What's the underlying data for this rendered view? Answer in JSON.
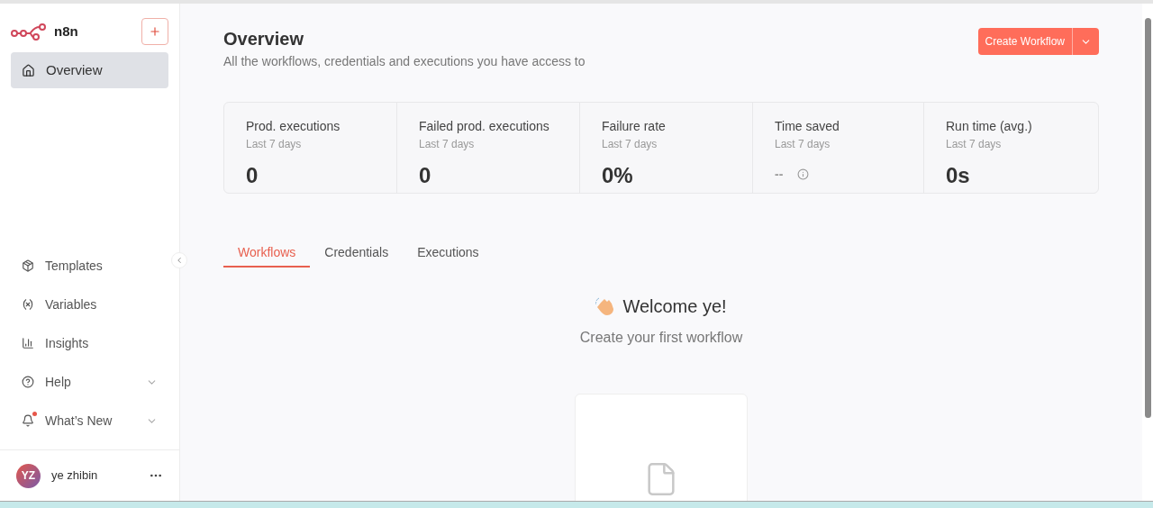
{
  "sidebar": {
    "brand": "n8n",
    "items": [
      {
        "kind": "home",
        "label": "Overview",
        "selected": true
      }
    ],
    "bottom_items": [
      {
        "kind": "templates",
        "label": "Templates",
        "expandable": false,
        "badge": false
      },
      {
        "kind": "variables",
        "label": "Variables",
        "expandable": false,
        "badge": false
      },
      {
        "kind": "insights",
        "label": "Insights",
        "expandable": false,
        "badge": false
      },
      {
        "kind": "help",
        "label": "Help",
        "expandable": true,
        "badge": false
      },
      {
        "kind": "news",
        "label": "What’s New",
        "expandable": true,
        "badge": true
      }
    ],
    "user": {
      "initials": "YZ",
      "name": "ye zhibin"
    }
  },
  "header": {
    "title": "Overview",
    "subtitle": "All the workflows, credentials and executions you have access to",
    "button": "Create Workflow"
  },
  "stats": [
    {
      "label": "Prod. executions",
      "period": "Last 7 days",
      "value": "0",
      "muted": false,
      "info": false
    },
    {
      "label": "Failed prod. executions",
      "period": "Last 7 days",
      "value": "0",
      "muted": false,
      "info": false
    },
    {
      "label": "Failure rate",
      "period": "Last 7 days",
      "value": "0%",
      "muted": false,
      "info": false
    },
    {
      "label": "Time saved",
      "period": "Last 7 days",
      "value": "--",
      "muted": true,
      "info": true
    },
    {
      "label": "Run time (avg.)",
      "period": "Last 7 days",
      "value": "0s",
      "muted": false,
      "info": false
    }
  ],
  "tabs": [
    {
      "label": "Workflows",
      "selected": true
    },
    {
      "label": "Credentials",
      "selected": false
    },
    {
      "label": "Executions",
      "selected": false
    }
  ],
  "welcome": {
    "title": "Welcome ye!",
    "subtitle": "Create your first workflow"
  }
}
